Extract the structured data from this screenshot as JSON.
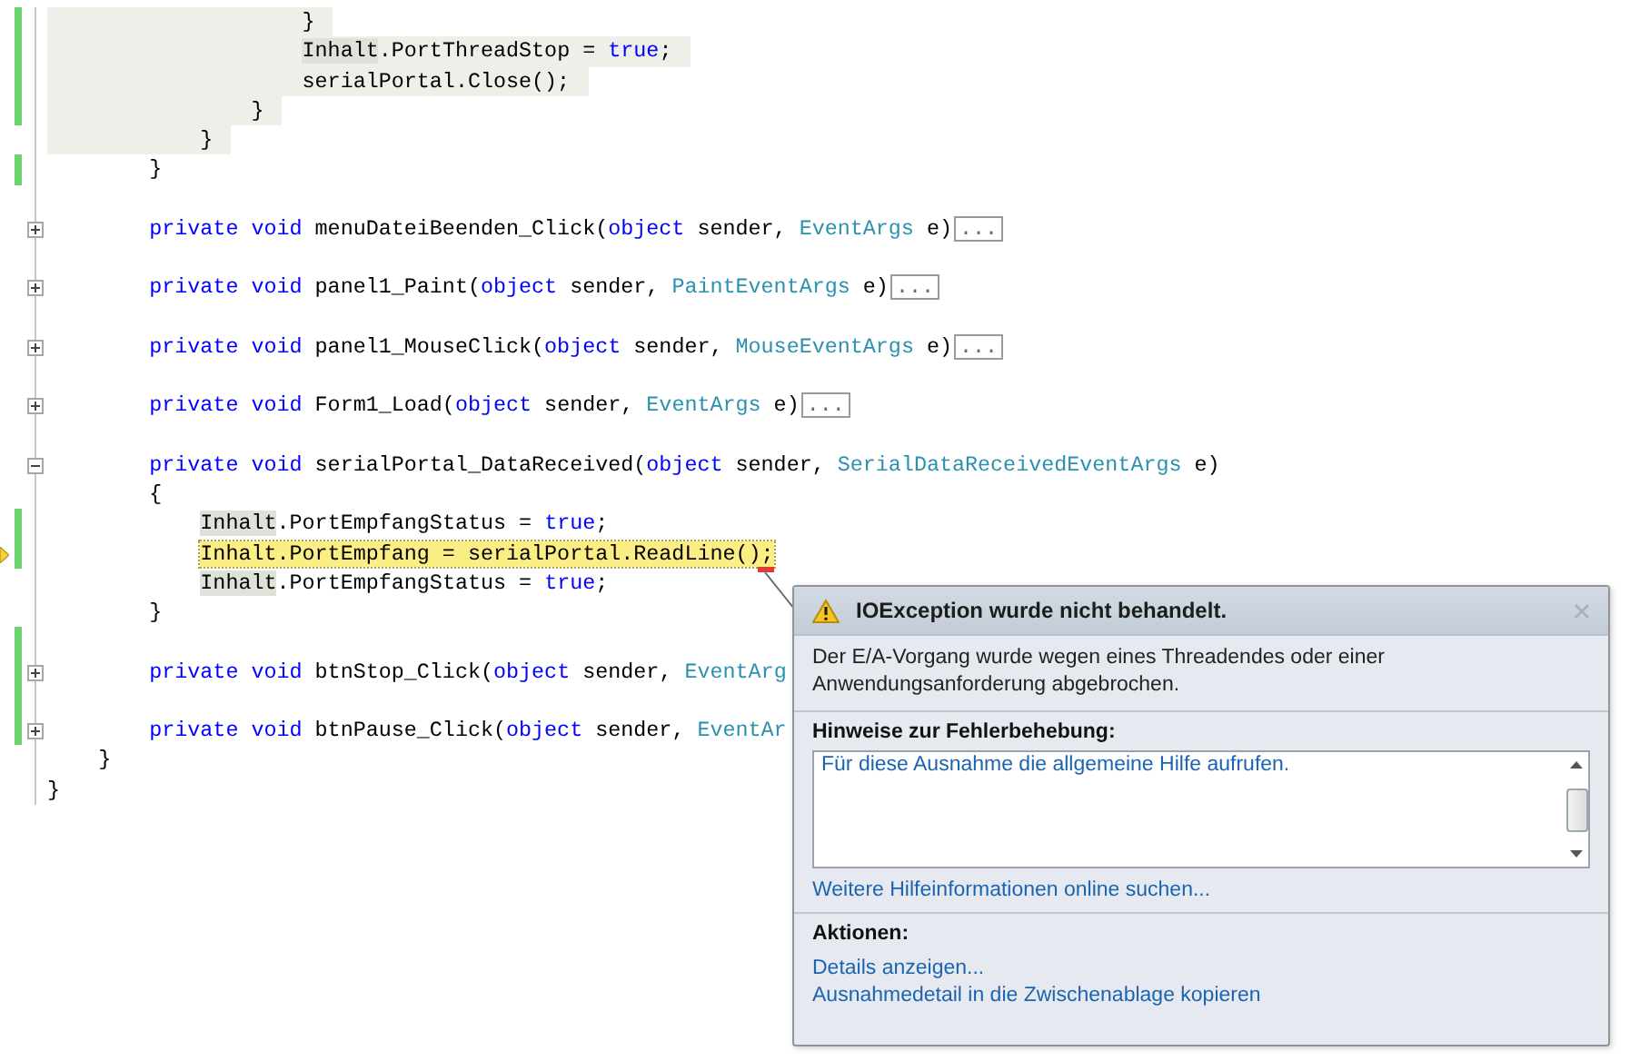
{
  "editor": {
    "lines": [
      {
        "changed": true,
        "shaded": true,
        "tokens": [
          {
            "kind": "plain",
            "text": "                    }"
          }
        ]
      },
      {
        "changed": true,
        "shaded": true,
        "tokens": [
          {
            "kind": "ref",
            "text": "                    Inhalt"
          },
          {
            "kind": "plain",
            "text": ".PortThreadStop = "
          },
          {
            "kind": "keyword",
            "text": "true"
          },
          {
            "kind": "plain",
            "text": ";"
          }
        ]
      },
      {
        "changed": true,
        "shaded": true,
        "tokens": [
          {
            "kind": "plain",
            "text": "                    serialPortal.Close();"
          }
        ]
      },
      {
        "changed": true,
        "shaded": true,
        "tokens": [
          {
            "kind": "plain",
            "text": "                }"
          }
        ]
      },
      {
        "changed": false,
        "shaded": true,
        "tokens": [
          {
            "kind": "plain",
            "text": "            }"
          }
        ]
      },
      {
        "changed": true,
        "tokens": [
          {
            "kind": "plain",
            "text": "        }"
          }
        ]
      },
      {
        "changed": false,
        "space_above": true,
        "collapsed": true,
        "tokens": [
          {
            "kind": "keyword",
            "text": "        private void"
          },
          {
            "kind": "plain",
            "text": " menuDateiBeenden_Click("
          },
          {
            "kind": "keyword",
            "text": "object"
          },
          {
            "kind": "plain",
            "text": " sender, "
          },
          {
            "kind": "type",
            "text": "EventArgs"
          },
          {
            "kind": "plain",
            "text": " e)"
          },
          {
            "kind": "collapsed",
            "text": "..."
          }
        ]
      },
      {
        "changed": false,
        "space_above": true,
        "collapsed": true,
        "tokens": [
          {
            "kind": "keyword",
            "text": "        private void"
          },
          {
            "kind": "plain",
            "text": " panel1_Paint("
          },
          {
            "kind": "keyword",
            "text": "object"
          },
          {
            "kind": "plain",
            "text": " sender, "
          },
          {
            "kind": "type",
            "text": "PaintEventArgs"
          },
          {
            "kind": "plain",
            "text": " e)"
          },
          {
            "kind": "collapsed",
            "text": "..."
          }
        ]
      },
      {
        "changed": false,
        "space_above": true,
        "collapsed": true,
        "tokens": [
          {
            "kind": "keyword",
            "text": "        private void"
          },
          {
            "kind": "plain",
            "text": " panel1_MouseClick("
          },
          {
            "kind": "keyword",
            "text": "object"
          },
          {
            "kind": "plain",
            "text": " sender, "
          },
          {
            "kind": "type",
            "text": "MouseEventArgs"
          },
          {
            "kind": "plain",
            "text": " e)"
          },
          {
            "kind": "collapsed",
            "text": "..."
          }
        ]
      },
      {
        "changed": false,
        "space_above": true,
        "collapsed": true,
        "tokens": [
          {
            "kind": "keyword",
            "text": "        private void"
          },
          {
            "kind": "plain",
            "text": " Form1_Load("
          },
          {
            "kind": "keyword",
            "text": "object"
          },
          {
            "kind": "plain",
            "text": " sender, "
          },
          {
            "kind": "type",
            "text": "EventArgs"
          },
          {
            "kind": "plain",
            "text": " e)"
          },
          {
            "kind": "collapsed",
            "text": "..."
          }
        ]
      },
      {
        "changed": false,
        "space_above": true,
        "collapsed": false,
        "tokens": [
          {
            "kind": "keyword",
            "text": "        private void"
          },
          {
            "kind": "plain",
            "text": " serialPortal_DataReceived("
          },
          {
            "kind": "keyword",
            "text": "object"
          },
          {
            "kind": "plain",
            "text": " sender, "
          },
          {
            "kind": "type",
            "text": "SerialDataReceivedEventArgs"
          },
          {
            "kind": "plain",
            "text": " e)"
          }
        ]
      },
      {
        "changed": false,
        "tokens": [
          {
            "kind": "plain",
            "text": "        {"
          }
        ]
      },
      {
        "changed": true,
        "tokens": [
          {
            "kind": "ref",
            "text": "            Inhalt"
          },
          {
            "kind": "plain",
            "text": ".PortEmpfangStatus = "
          },
          {
            "kind": "keyword",
            "text": "true"
          },
          {
            "kind": "plain",
            "text": ";"
          }
        ]
      },
      {
        "changed": true,
        "current": true,
        "tokens": [
          {
            "kind": "plain",
            "text": "            Inhalt.PortEmpfang = serialPortal.ReadLine();"
          }
        ]
      },
      {
        "changed": false,
        "tokens": [
          {
            "kind": "ref",
            "text": "            Inhalt"
          },
          {
            "kind": "plain",
            "text": ".PortEmpfangStatus = "
          },
          {
            "kind": "keyword",
            "text": "true"
          },
          {
            "kind": "plain",
            "text": ";"
          }
        ]
      },
      {
        "changed": false,
        "tokens": [
          {
            "kind": "plain",
            "text": "        }"
          }
        ]
      },
      {
        "changed": true
      },
      {
        "changed": true,
        "collapsed": true,
        "tokens": [
          {
            "kind": "keyword",
            "text": "        private void"
          },
          {
            "kind": "plain",
            "text": " btnStop_Click("
          },
          {
            "kind": "keyword",
            "text": "object"
          },
          {
            "kind": "plain",
            "text": " sender, "
          },
          {
            "kind": "type",
            "text": "EventArg"
          }
        ]
      },
      {
        "changed": true
      },
      {
        "changed": true,
        "collapsed": true,
        "tokens": [
          {
            "kind": "keyword",
            "text": "        private void"
          },
          {
            "kind": "plain",
            "text": " btnPause_Click("
          },
          {
            "kind": "keyword",
            "text": "object"
          },
          {
            "kind": "plain",
            "text": " sender, "
          },
          {
            "kind": "type",
            "text": "EventAr"
          }
        ]
      },
      {
        "changed": false,
        "tokens": [
          {
            "kind": "plain",
            "text": "    }"
          }
        ]
      },
      {
        "changed": false,
        "tokens": [
          {
            "kind": "plain",
            "text": "}"
          }
        ]
      }
    ]
  },
  "exception_popup": {
    "title": "IOException wurde nicht behandelt.",
    "message": "Der E/A-Vorgang wurde wegen eines Threadendes oder einer Anwendungsanforderung abgebrochen.",
    "tips_heading": "Hinweise zur Fehlerbehebung:",
    "tips": [
      "Für diese Ausnahme die allgemeine Hilfe aufrufen."
    ],
    "online_link": "Weitere Hilfeinformationen online suchen...",
    "actions_heading": "Aktionen:",
    "actions": [
      "Details anzeigen...",
      "Ausnahmedetail in die Zwischenablage kopieren"
    ]
  }
}
